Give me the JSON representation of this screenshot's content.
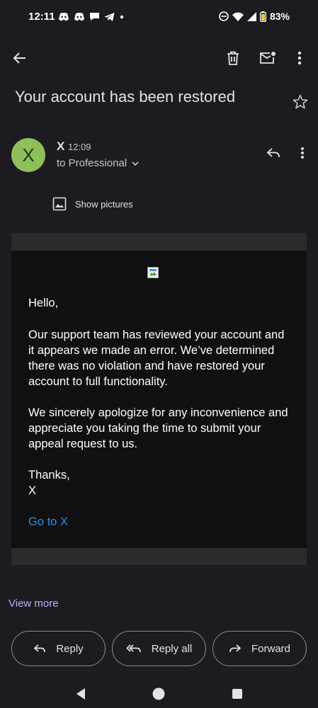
{
  "status": {
    "time": "12:11",
    "battery": "83%",
    "notification_icons": [
      "discord-icon",
      "discord-icon",
      "chat-bubble-icon",
      "telegram-icon",
      "dot-icon"
    ],
    "system_icons": [
      "do-not-disturb-icon",
      "wifi-icon",
      "cell-signal-icon",
      "battery-icon"
    ]
  },
  "app_bar": {
    "icons": [
      "back-arrow-icon",
      "delete-icon",
      "mark-unread-icon",
      "more-vert-icon"
    ]
  },
  "email": {
    "subject": "Your account has been restored",
    "sender": {
      "avatar_letter": "X",
      "name": "X",
      "time": "12:09",
      "recipients": "to Professional"
    },
    "show_pictures": "Show pictures",
    "body": {
      "greeting": "Hello,",
      "paragraph1": "Our support team has reviewed your account and it appears we made an error. We’ve determined there was no violation and have restored your account to full functionality.",
      "paragraph2": "We sincerely apologize for any inconvenience and appreciate you taking the time to submit your appeal request to us.",
      "signoff": "Thanks,",
      "signature": "X",
      "link": "Go to X"
    }
  },
  "view_more": "View more",
  "actions": {
    "reply": "Reply",
    "reply_all": "Reply all",
    "forward": "Forward"
  },
  "colors": {
    "background": "#1c1b20",
    "avatar": "#8fbf5a",
    "link": "#2f8fdc",
    "view_more": "#b9b2f5"
  }
}
